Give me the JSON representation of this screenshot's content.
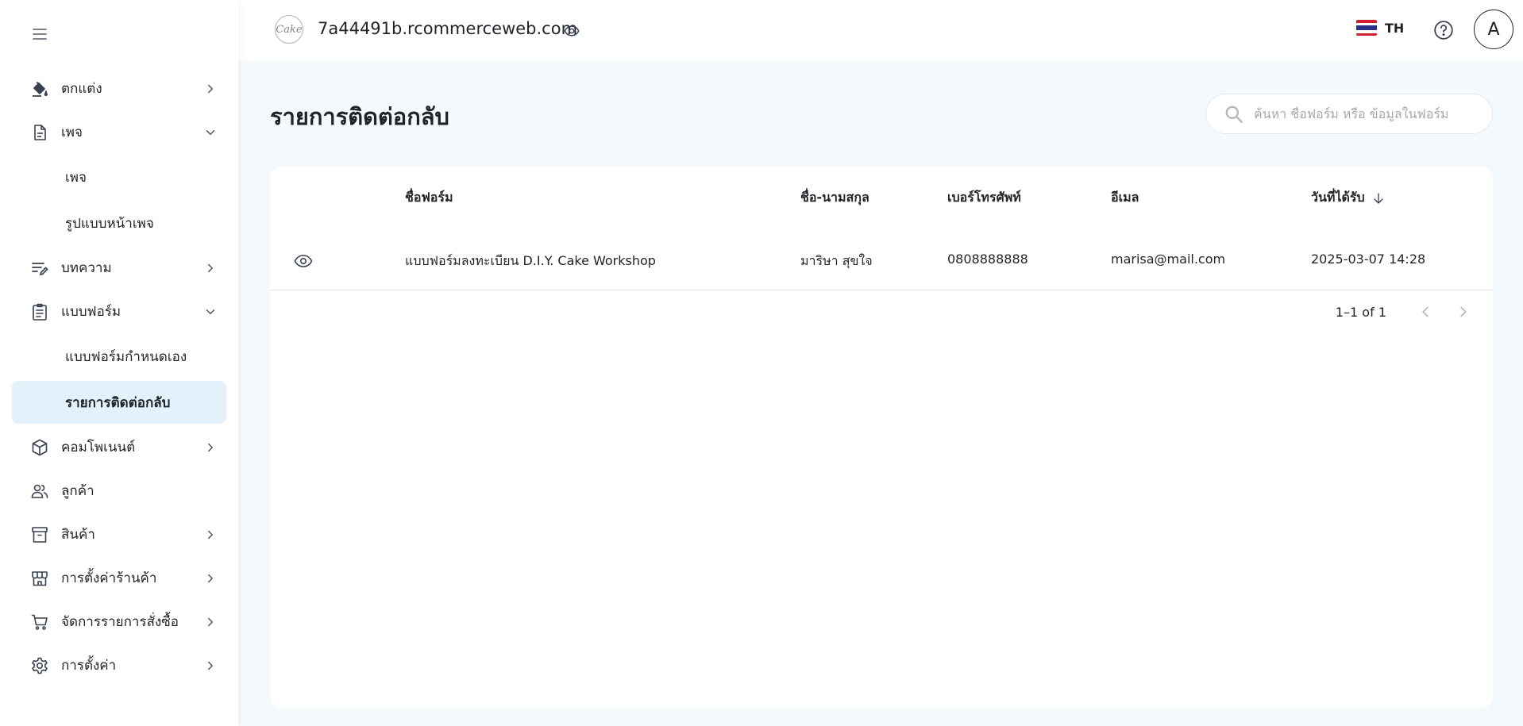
{
  "topbar": {
    "logo_text": "Cake",
    "site_name": "7a44491b.rcommerceweb.com",
    "lang_code": "TH",
    "avatar_initial": "A",
    "flag_colors": [
      "#d0202f",
      "#ffffff",
      "#2a2f86",
      "#ffffff",
      "#d0202f"
    ]
  },
  "sidebar": {
    "items": [
      {
        "label": "ตกแต่ง",
        "icon": "paint-bucket-icon",
        "chevron": "right"
      },
      {
        "label": "เพจ",
        "icon": "document-icon",
        "chevron": "down"
      },
      {
        "label": "บทความ",
        "icon": "article-edit-icon",
        "chevron": "right"
      },
      {
        "label": "แบบฟอร์ม",
        "icon": "clipboard-icon",
        "chevron": "down"
      },
      {
        "label": "คอมโพเนนต์",
        "icon": "cube-icon",
        "chevron": "right"
      },
      {
        "label": "ลูกค้า",
        "icon": "users-icon",
        "chevron": "none"
      },
      {
        "label": "สินค้า",
        "icon": "archive-box-icon",
        "chevron": "right"
      },
      {
        "label": "การตั้งค่าร้านค้า",
        "icon": "storefront-icon",
        "chevron": "right"
      },
      {
        "label": "จัดการรายการสั่งซื้อ",
        "icon": "cart-icon",
        "chevron": "right"
      },
      {
        "label": "การตั้งค่า",
        "icon": "gear-icon",
        "chevron": "right"
      }
    ],
    "page_subitems": [
      "เพจ",
      "รูปแบบหน้าเพจ"
    ],
    "form_subitems": [
      "แบบฟอร์มกำหนดเอง",
      "รายการติดต่อกลับ"
    ]
  },
  "main": {
    "title": "รายการติดต่อกลับ",
    "search_placeholder": "ค้นหา ชื่อฟอร์ม หรือ ข้อมูลในฟอร์ม",
    "columns": [
      "ชื่อฟอร์ม",
      "ชื่อ-นามสกุล",
      "เบอร์โทรศัพท์",
      "อีเมล",
      "วันที่ได้รับ"
    ],
    "rows": [
      {
        "form_name": "แบบฟอร์มลงทะเบียน D.I.Y. Cake Workshop",
        "full_name": "มาริษา สุขใจ",
        "phone": "0808888888",
        "email": "marisa@mail.com",
        "received": "2025-03-07 14:28"
      }
    ],
    "pagination": "1–1 of 1"
  },
  "colors": {
    "active_bg": "#e3f1fb",
    "page_bg": "#f3f9fc"
  }
}
